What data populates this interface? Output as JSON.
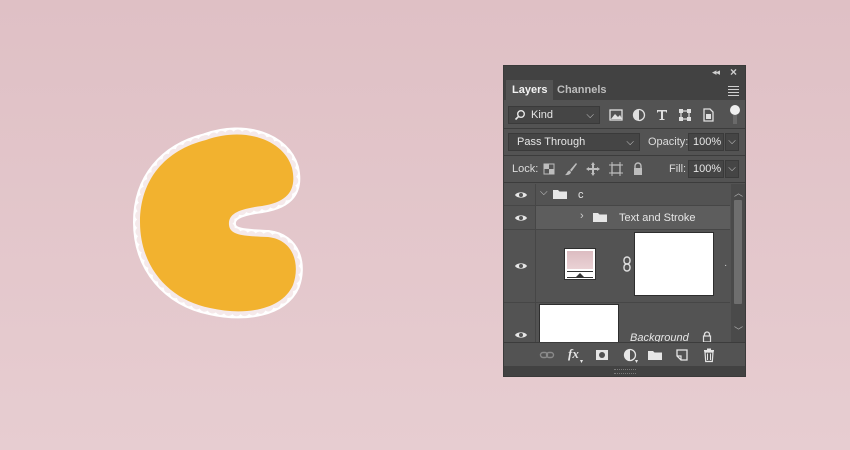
{
  "canvas": {
    "background_color": "#e3c6cb",
    "letter_fill_color": "#f2b22f",
    "letter_stroke_color": "#ffffff"
  },
  "panel": {
    "tabs": [
      {
        "label": "Layers",
        "active": true
      },
      {
        "label": "Channels",
        "active": false
      }
    ],
    "filter": {
      "kind_label": "Kind"
    },
    "blend": {
      "mode": "Pass Through",
      "opacity_label": "Opacity:",
      "opacity_value": "100%"
    },
    "lock": {
      "label": "Lock:",
      "fill_label": "Fill:",
      "fill_value": "100%"
    },
    "layers": [
      {
        "name": "c",
        "type": "group",
        "expanded": true
      },
      {
        "name": "Text and Stroke",
        "type": "group",
        "expanded": false,
        "selected": true
      },
      {
        "name": "",
        "type": "adjustment-with-mask"
      },
      {
        "name": "Background",
        "type": "background",
        "locked": true
      }
    ],
    "bottom_icons": [
      "link-icon",
      "fx-icon",
      "add-mask-icon",
      "adjustment-icon",
      "folder-icon",
      "new-layer-icon",
      "trash-icon"
    ],
    "fx_label": "fx"
  }
}
